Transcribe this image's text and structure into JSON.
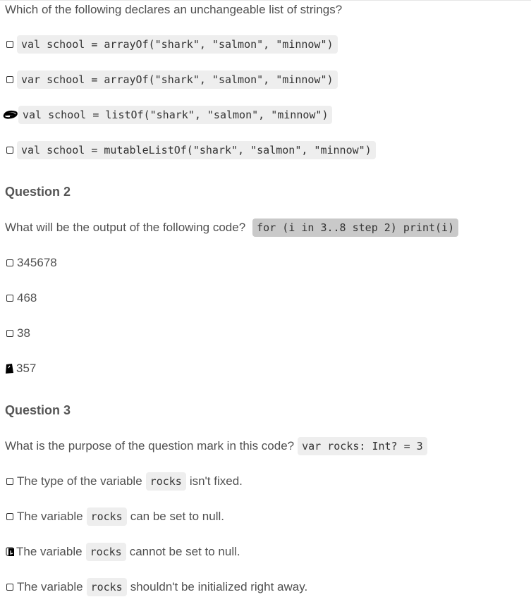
{
  "q1": {
    "prompt": "Which of the following declares an unchangeable list of strings?",
    "options": [
      {
        "code": "val school = arrayOf(\"shark\", \"salmon\", \"minnow\")",
        "checked": false
      },
      {
        "code": "var school = arrayOf(\"shark\", \"salmon\", \"minnow\")",
        "checked": false
      },
      {
        "code": "val school = listOf(\"shark\", \"salmon\", \"minnow\")",
        "checked": true
      },
      {
        "code": "val school = mutableListOf(\"shark\", \"salmon\", \"minnow\")",
        "checked": false
      }
    ]
  },
  "q2": {
    "heading": "Question 2",
    "prompt": "What will be the output of the following code?",
    "code": "for (i in 3..8 step 2) print(i)",
    "options": [
      {
        "label": "345678",
        "checked": false
      },
      {
        "label": "468",
        "checked": false
      },
      {
        "label": "38",
        "checked": false
      },
      {
        "label": "357",
        "checked": true
      }
    ]
  },
  "q3": {
    "heading": "Question 3",
    "prompt": "What is the purpose of the question mark in this code?",
    "code": "var rocks: Int? = 3",
    "options": [
      {
        "before": "The type of the variable",
        "code": "rocks",
        "after": "isn't fixed.",
        "checked": false
      },
      {
        "before": "The variable",
        "code": "rocks",
        "after": "can be set to null.",
        "checked": false
      },
      {
        "before": "The variable",
        "code": "rocks",
        "after": "cannot be set to null.",
        "checked": true
      },
      {
        "before": "The variable",
        "code": "rocks",
        "after": "shouldn't be initialized right away.",
        "checked": false
      }
    ]
  },
  "colors": {
    "text": "#505050",
    "code_bg": "#eeeeee",
    "code_bg_highlight": "#c9c9c9",
    "mark": "#000000"
  }
}
